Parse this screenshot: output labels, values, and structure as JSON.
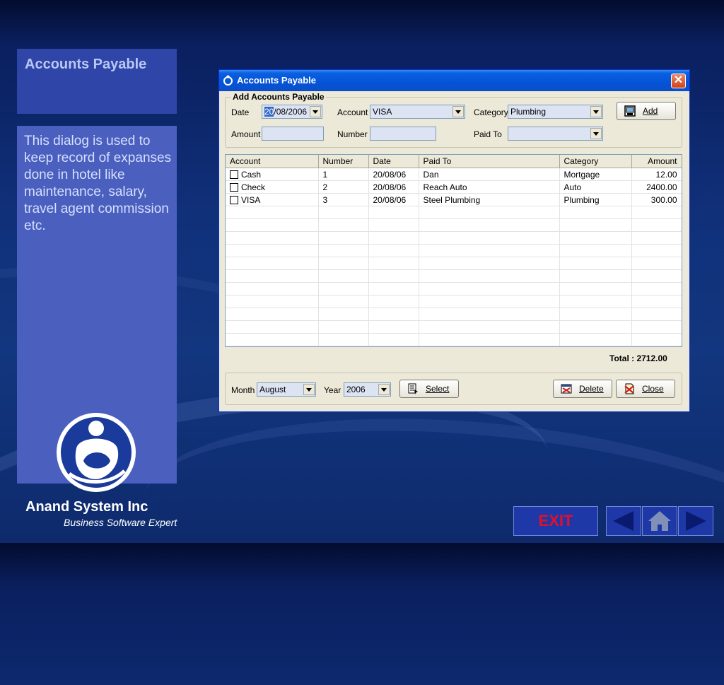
{
  "sidebar": {
    "title": "Accounts Payable",
    "description": "This dialog is used to keep record of expanses done in hotel like maintenance, salary, travel agent commission etc.",
    "company": "Anand System Inc",
    "tagline": "Business Software Expert"
  },
  "window": {
    "title": "Accounts Payable",
    "close_icon": "close-icon",
    "group_title": "Add Accounts Payable",
    "date_label": "Date",
    "date_day": "20",
    "date_rest": "/08/2006",
    "account_label": "Account",
    "account_value": "VISA",
    "category_label": "Category",
    "category_value": "Plumbing",
    "add_label": "Add",
    "amount_label": "Amount",
    "amount_value": "",
    "number_label": "Number",
    "number_value": "",
    "paidto_label": "Paid To",
    "paidto_value": ""
  },
  "table": {
    "headers": [
      "Account",
      "Number",
      "Date",
      "Paid To",
      "Category",
      "Amount"
    ],
    "rows": [
      [
        "Cash",
        "1",
        "20/08/06",
        "Dan",
        "Mortgage",
        "12.00"
      ],
      [
        "Check",
        "2",
        "20/08/06",
        "Reach Auto",
        "Auto",
        "2400.00"
      ],
      [
        "VISA",
        "3",
        "20/08/06",
        "Steel Plumbing",
        "Plumbing",
        "300.00"
      ]
    ],
    "total": "Total : 2712.00"
  },
  "footer": {
    "month_label": "Month",
    "month_value": "August",
    "year_label": "Year",
    "year_value": "2006",
    "select_label": "Select",
    "delete_label": "Delete",
    "close_label": "Close"
  },
  "nav": {
    "exit_label": "EXIT",
    "prev_icon": "left-arrow-icon",
    "home_icon": "home-icon",
    "next_icon": "right-arrow-icon"
  },
  "colors": {
    "slide_bg": "#10307a",
    "title_box": "#3045a8",
    "desc_box": "#4a5fbe",
    "window_bg": "#ece9d8",
    "titlebar": "#0554d8",
    "exit_text": "#e0102a"
  }
}
